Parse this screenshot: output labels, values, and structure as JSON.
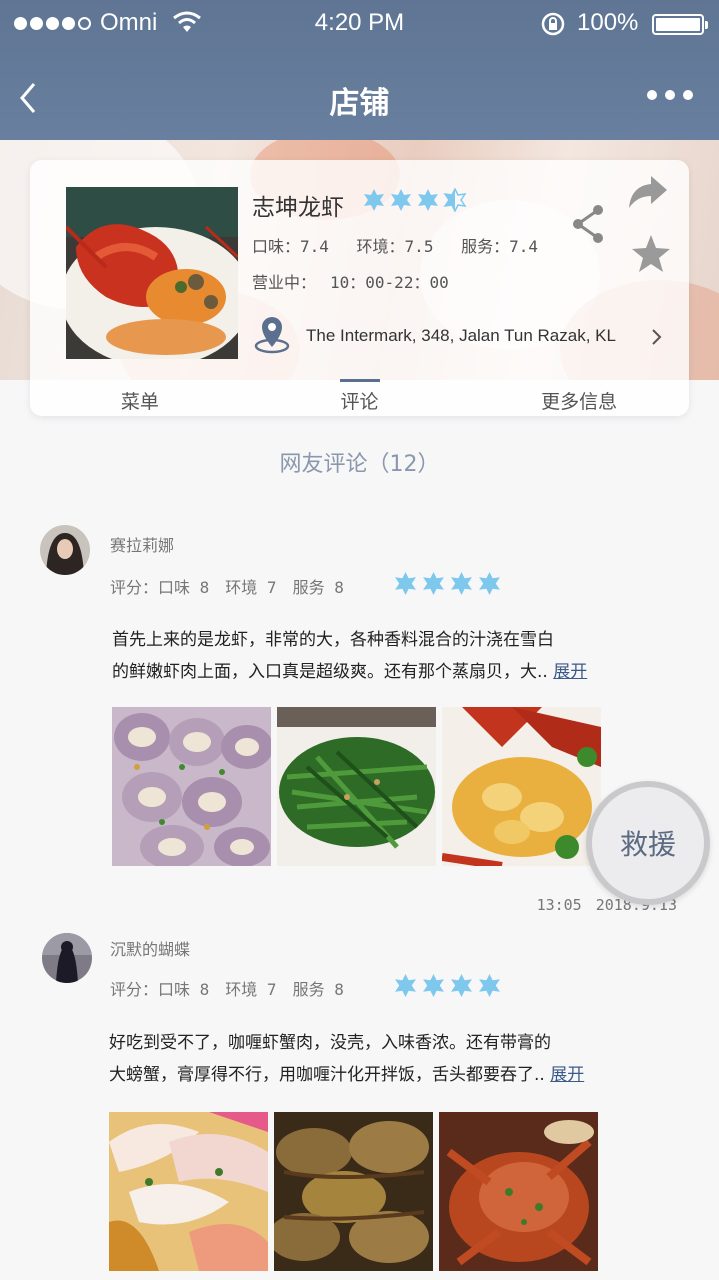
{
  "status": {
    "carrier": "Omni",
    "time": "4:20 PM",
    "battery": "100%"
  },
  "nav": {
    "title": "店铺"
  },
  "shop": {
    "name": "志坤龙虾",
    "rating_stars": 3.5,
    "scores": {
      "taste": "口味：7.4",
      "environment": "环境：7.5",
      "service": "服务：7.4"
    },
    "status_label": "营业中：",
    "hours": "10：00-22：00",
    "address": "The Intermark, 348, Jalan Tun Razak, KL"
  },
  "tabs": [
    {
      "label": "菜单"
    },
    {
      "label": "评论"
    },
    {
      "label": "更多信息"
    }
  ],
  "reviews_title": "网友评论（12）",
  "reviews": [
    {
      "name": "赛拉莉娜",
      "rating_label": "评分：",
      "taste": "口味 8",
      "environment": "环境 7",
      "service": "服务 8",
      "stars": 4,
      "text_line1": "首先上来的是龙虾，非常的大，各种香料混合的汁浇在雪白",
      "text_line2": "的鲜嫩虾肉上面，入口真是超级爽。还有那个蒸扇贝，大..",
      "expand": "展开",
      "time": "13:05",
      "date": "2018.9.13"
    },
    {
      "name": "沉默的蝴蝶",
      "rating_label": "评分：",
      "taste": "口味 8",
      "environment": "环境 7",
      "service": "服务 8",
      "stars": 4,
      "text_line1": "好吃到受不了，咖喱虾蟹肉，没壳，入味香浓。还有带膏的",
      "text_line2": "大螃蟹，膏厚得不行，用咖喱汁化开拌饭，舌头都要吞了..",
      "expand": "展开"
    }
  ],
  "rescue_button": "救援",
  "colors": {
    "nav_bg": "#687f9f",
    "star": "#7ec8ee",
    "accent": "#5b6f8e",
    "link": "#3c5a88"
  }
}
